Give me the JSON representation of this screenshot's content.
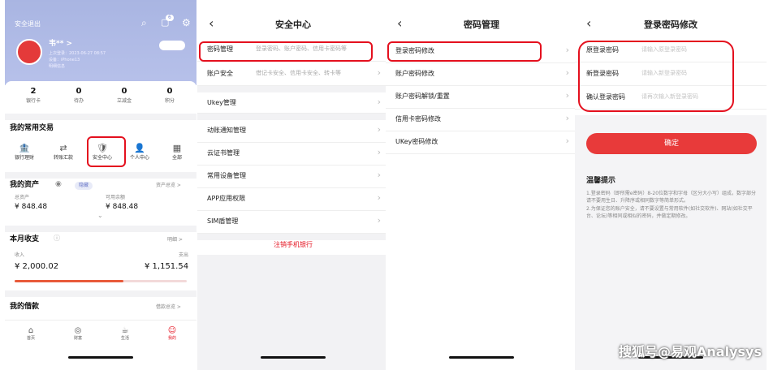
{
  "screen1": {
    "logout": "安全退出",
    "username": "韦** >",
    "last_login": "上次登录：2023-06-27 08:57",
    "device": "设备：iPhone13",
    "more_info": "明细信息",
    "badge": "6",
    "stats": [
      {
        "num": "2",
        "label": "银行卡"
      },
      {
        "num": "0",
        "label": "待办"
      },
      {
        "num": "0",
        "label": "立减金"
      },
      {
        "num": "0",
        "label": "积分"
      }
    ],
    "trade_title": "我的常用交易",
    "trades": [
      {
        "icon": "🏦",
        "label": "银行理财"
      },
      {
        "icon": "⇄",
        "label": "转账汇款"
      },
      {
        "icon": "🛡",
        "label": "安全中心"
      },
      {
        "icon": "👤",
        "label": "个人中心"
      },
      {
        "icon": "▦",
        "label": "全部"
      }
    ],
    "assets_title": "我的资产",
    "assets_tag": "隐藏",
    "assets_link": "资产总览 >",
    "total_label": "总资产",
    "total_value": "¥ 848.48",
    "avail_label": "可用余额",
    "avail_value": "¥ 848.48",
    "income_title": "本月收支",
    "income_link": "明细 >",
    "income_label": "收入",
    "income_value": "¥ 2,000.02",
    "expense_label": "支出",
    "expense_value": "¥ 1,151.54",
    "expense_ratio": 0.63,
    "loan_title": "我的借款",
    "loan_link": "借款总览 >",
    "tabs": [
      {
        "icon": "⌂",
        "label": "首页"
      },
      {
        "icon": "◎",
        "label": "财富"
      },
      {
        "icon": "☕",
        "label": "生活"
      },
      {
        "icon": "☺",
        "label": "我的"
      }
    ]
  },
  "screen2": {
    "title": "安全中心",
    "rows_top": [
      {
        "label": "密码管理",
        "sub": "登录密码、账户密码、信用卡密码等"
      },
      {
        "label": "账户安全",
        "sub": "借记卡安全、信用卡安全、转卡等"
      }
    ],
    "rows": [
      "Ukey管理",
      "动账通知管理",
      "云证书管理",
      "常用设备管理",
      "APP应用权限",
      "SIM盾管理"
    ],
    "logout": "注销手机银行"
  },
  "screen3": {
    "title": "密码管理",
    "rows": [
      "登录密码修改",
      "账户密码修改",
      "账户密码解锁/重置",
      "信用卡密码修改",
      "UKey密码修改"
    ]
  },
  "screen4": {
    "title": "登录密码修改",
    "fields": [
      {
        "label": "原登录密码",
        "placeholder": "请输入原登录密码"
      },
      {
        "label": "新登录密码",
        "placeholder": "请输入新登录密码"
      },
      {
        "label": "确认登录密码",
        "placeholder": "请再次输入新登录密码"
      }
    ],
    "confirm": "确定",
    "tips_title": "温馨提示",
    "tips": "1.登录密码（即所需e密码）8-20位数字和字母（区分大小写）组成，数字部分请不要用生日、升降序或相同数字等简单形式。\n2.为保证您的账户安全，请不要设置与常用软件(如社交软件)、网站(如社交平台、论坛)等相同或相似的密码，并做定期修改。"
  },
  "watermark": "搜狐号@易观Analysys"
}
